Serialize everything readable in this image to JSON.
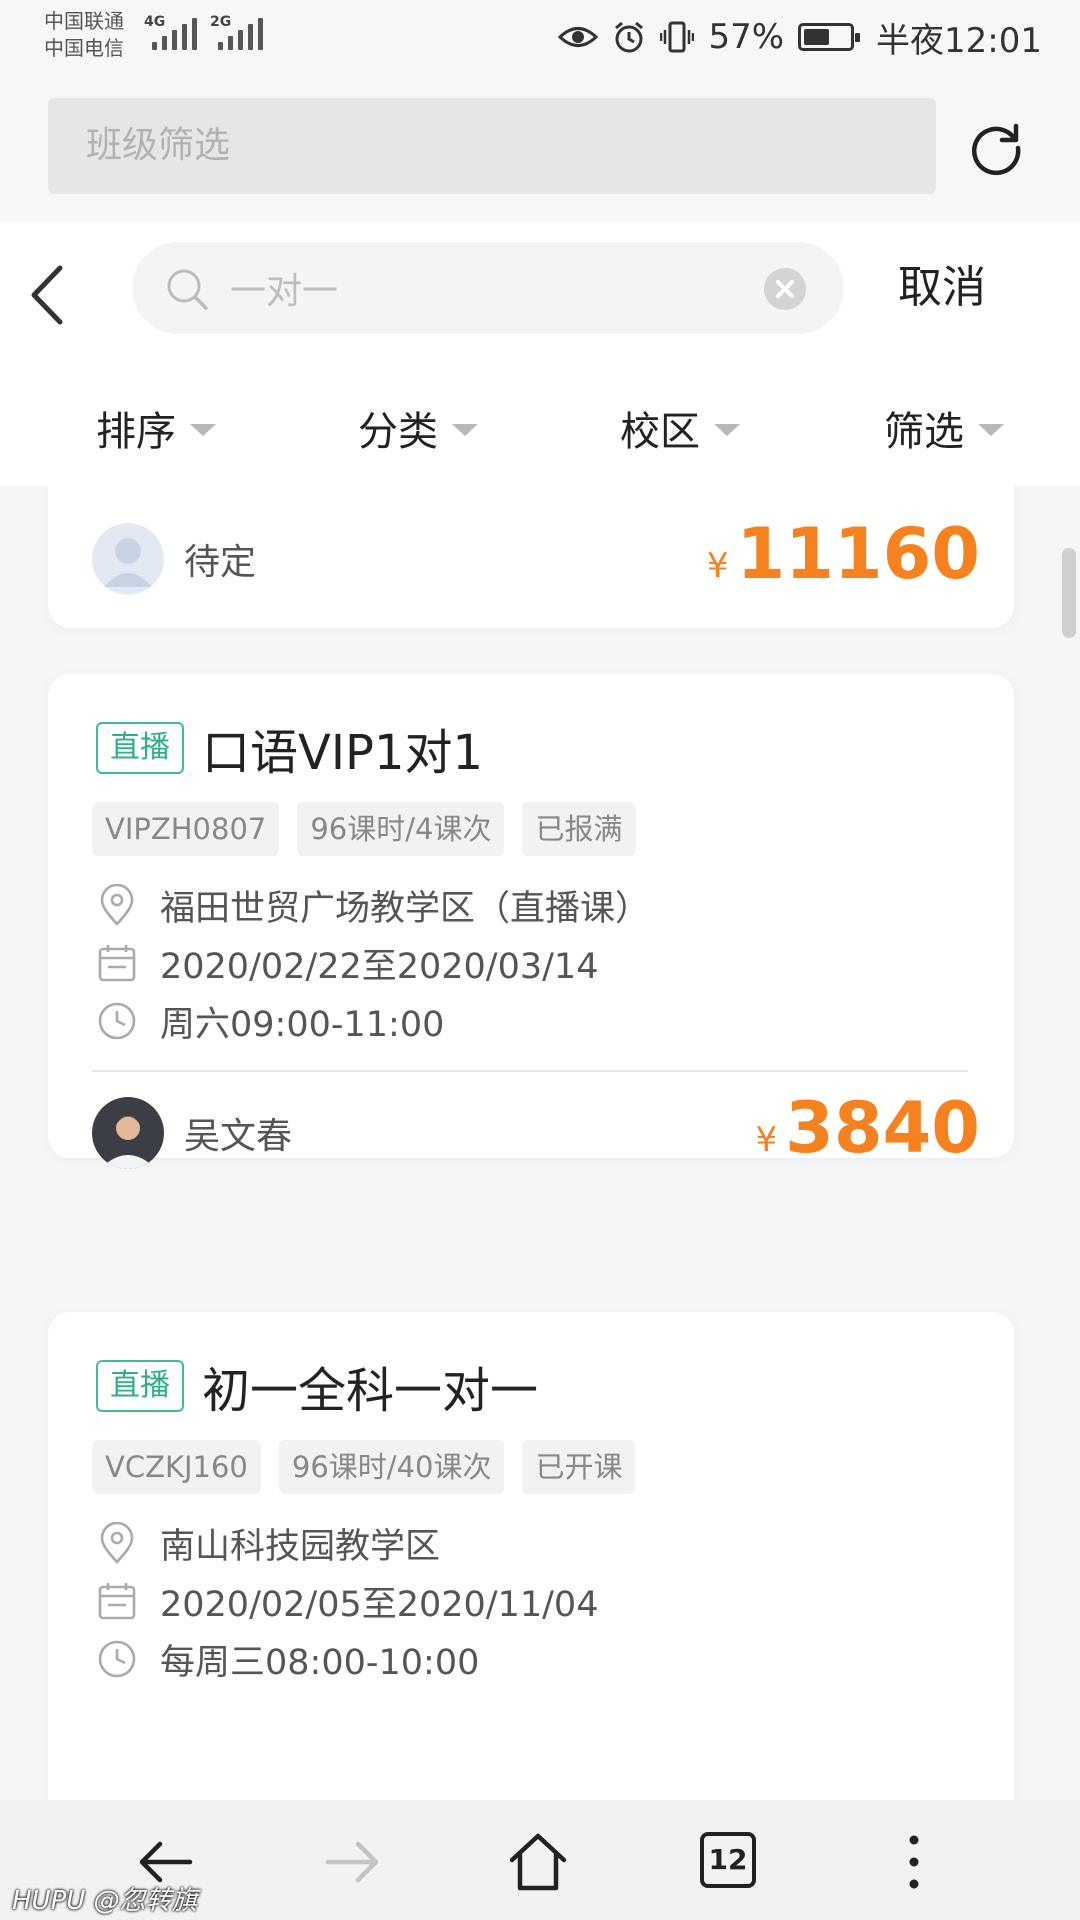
{
  "status_bar": {
    "carrier_1": "中国联通",
    "carrier_2": "中国电信",
    "net_1": "4G",
    "net_2": "2G",
    "battery_level": 0.57,
    "battery": "57%",
    "time": "半夜12:01"
  },
  "browser": {
    "url_placeholder": "班级筛选",
    "tab_count": "12"
  },
  "search": {
    "query": "一对一",
    "cancel_label": "取消"
  },
  "filters": [
    {
      "label": "排序"
    },
    {
      "label": "分类"
    },
    {
      "label": "校区"
    },
    {
      "label": "筛选"
    }
  ],
  "courses": [
    {
      "teacher": "待定",
      "currency": "¥",
      "price": "11160"
    },
    {
      "badge": "直播",
      "title": "口语VIP1对1",
      "tags": [
        "VIPZH0807",
        "96课时/4课次",
        "已报满"
      ],
      "location": "福田世贸广场教学区（直播课）",
      "dates": "2020/02/22至2020/03/14",
      "schedule": "周六09:00-11:00",
      "teacher": "吴文春",
      "currency": "¥",
      "price": "3840"
    },
    {
      "badge": "直播",
      "title": "初一全科一对一",
      "tags": [
        "VCZKJ160",
        "96课时/40课次",
        "已开课"
      ],
      "location": "南山科技园教学区",
      "dates": "2020/02/05至2020/11/04",
      "schedule": "每周三08:00-10:00"
    }
  ],
  "watermark": "HUPU @忽转旗",
  "colors": {
    "accent_green": "#3cbc98",
    "price_orange": "#f6821f"
  }
}
